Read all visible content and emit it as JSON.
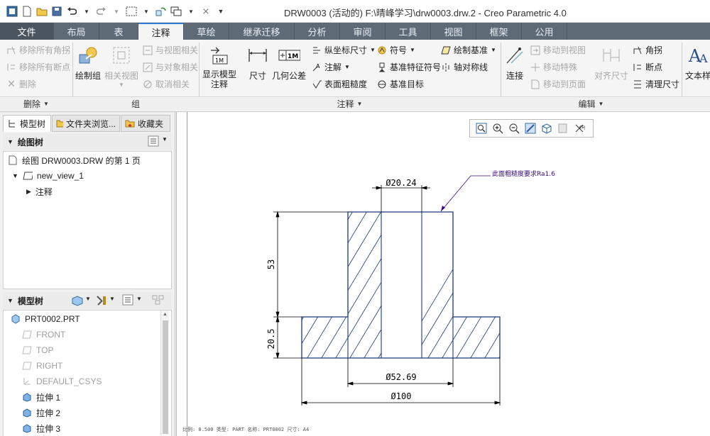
{
  "window": {
    "title": "DRW0003 (活动的) F:\\晴峰学习\\drw0003.drw.2 - Creo Parametric 4.0"
  },
  "quick_access": [
    "app-icon",
    "new-icon",
    "open-icon",
    "save-icon",
    "undo-icon",
    "redo-icon",
    "select-box-icon",
    "regenerate-icon",
    "windows-icon",
    "close-window-icon",
    "customize-icon"
  ],
  "menu_tabs": [
    {
      "label": "文件",
      "width": 76
    },
    {
      "label": "布局",
      "width": 64
    },
    {
      "label": "表",
      "width": 55
    },
    {
      "label": "注释",
      "width": 64
    },
    {
      "label": "草绘",
      "width": 64
    },
    {
      "label": "继承迁移",
      "width": 92
    },
    {
      "label": "分析",
      "width": 64
    },
    {
      "label": "审阅",
      "width": 64
    },
    {
      "label": "工具",
      "width": 64
    },
    {
      "label": "视图",
      "width": 64
    },
    {
      "label": "框架",
      "width": 64
    },
    {
      "label": "公用",
      "width": 64
    }
  ],
  "active_tab": "注释",
  "ribbon": {
    "delete_group": {
      "remove_all_corners": "移除所有角拐",
      "remove_all_breaks": "移除所有断点",
      "delete": "删除",
      "footer": "删除"
    },
    "group_group": {
      "draw_group": "绘制组",
      "related_view": "相关视图",
      "related_to_view": "与视图相关",
      "related_to_object": "与对象相关",
      "unrelate": "取消相关",
      "footer": "组"
    },
    "annotate_group": {
      "show_model_annotations": "显示模型\n注释",
      "dimension": "尺寸",
      "geometric_tolerance": "几何公差",
      "ordinate_dimension": "纵坐标尺寸",
      "note": "注解",
      "surface_finish": "表面粗糙度",
      "symbol": "符号",
      "datum_feature_symbol": "基准特征符号",
      "datum_target": "基准目标",
      "draw_datum": "绘制基准",
      "axis_symmetry": "轴对称线",
      "footer": "注释"
    },
    "edit_group": {
      "connect": "连接",
      "move_to_view": "移动到视图",
      "move_special": "移动特殊",
      "move_to_page": "移动到页面",
      "align_dimensions": "对齐尺寸",
      "corner": "角拐",
      "break": "断点",
      "cleanup_dimensions": "清理尺寸",
      "footer": "编辑"
    },
    "text_style": "文本样"
  },
  "left_panel": {
    "tabs": [
      {
        "label": "模型树",
        "icon": "model-tree-icon"
      },
      {
        "label": "文件夹浏览...",
        "icon": "folder-browser-icon"
      },
      {
        "label": "收藏夹",
        "icon": "favorites-icon"
      }
    ],
    "drawing_tree": {
      "header": "绘图树",
      "items": [
        {
          "label": "绘图 DRW0003.DRW 的第 1 页"
        },
        {
          "label": "new_view_1"
        },
        {
          "label": "注释"
        }
      ]
    },
    "model_tree": {
      "header": "模型树",
      "items": [
        {
          "label": "PRT0002.PRT",
          "dim": false
        },
        {
          "label": "FRONT",
          "dim": true
        },
        {
          "label": "TOP",
          "dim": true
        },
        {
          "label": "RIGHT",
          "dim": true
        },
        {
          "label": "DEFAULT_CSYS",
          "dim": true
        },
        {
          "label": "拉伸 1",
          "dim": false
        },
        {
          "label": "拉伸 2",
          "dim": false
        },
        {
          "label": "拉伸 3",
          "dim": false
        }
      ]
    }
  },
  "drawing": {
    "dim_top": "Ø20.24",
    "dim_mid": "Ø52.69",
    "dim_bottom": "Ø100",
    "dim_height_upper": "53",
    "dim_height_lower": "20.5",
    "note": "此面粗糙度要求Ra1.6",
    "status_line": "比例: 0.500   类型: PART   名称: PRT0002   尺寸: A4"
  },
  "colors": {
    "accent": "#2e7bcf",
    "part_outline": "#1a3a7a",
    "dim_color": "#000000",
    "note_color": "#3a0a8a"
  }
}
